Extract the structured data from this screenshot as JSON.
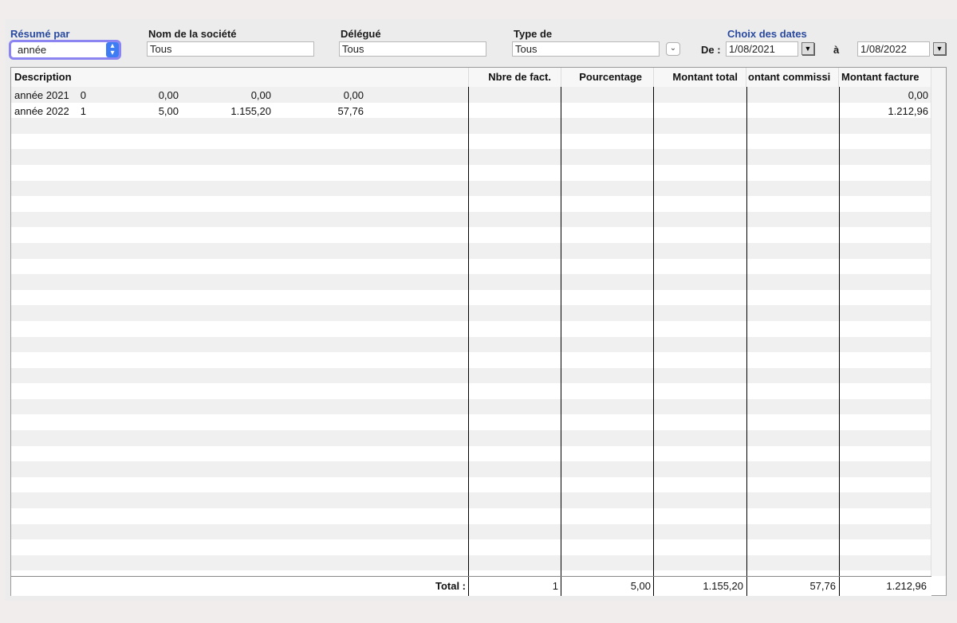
{
  "filters": {
    "resume_par": {
      "label": "Résumé par",
      "value": "année"
    },
    "societe": {
      "label": "Nom de la société",
      "value": "Tous"
    },
    "delegue": {
      "label": "Délégué",
      "value": "Tous"
    },
    "type": {
      "label": "Type de",
      "value": "Tous"
    },
    "dates": {
      "label": "Choix des dates",
      "from_label": "De :",
      "from_value": "1/08/2021",
      "to_label": "à",
      "to_value": "1/08/2022"
    }
  },
  "table": {
    "columns": [
      "Description",
      "Nbre de fact.",
      "Pourcentage",
      "Montant total",
      "ontant commissi",
      "Montant facture"
    ],
    "rows": [
      [
        "année 2021",
        "0",
        "0,00",
        "0,00",
        "0,00",
        "0,00"
      ],
      [
        "année 2022",
        "1",
        "5,00",
        "1.155,20",
        "57,76",
        "1.212,96"
      ]
    ],
    "total": {
      "label": "Total :",
      "values": [
        "1",
        "5,00",
        "1.155,20",
        "57,76",
        "1.212,96"
      ]
    }
  },
  "colors": {
    "accent": "#2a4aa0",
    "focus_ring": "#8c84f0",
    "stepper": "#3d7cf2"
  }
}
